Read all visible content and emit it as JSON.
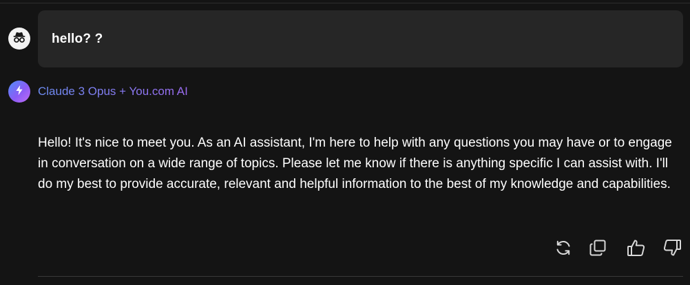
{
  "user_message": {
    "avatar_icon": "incognito-icon",
    "text": "hello? ?"
  },
  "assistant": {
    "avatar_icon": "lightning-bolt-icon",
    "model_name": "Claude 3 Opus + You.com AI",
    "response": "Hello! It's nice to meet you. As an AI assistant, I'm here to help with any questions you may have or to engage in conversation on a wide range of topics. Please let me know if there is anything specific I can assist with. I'll do my best to provide accurate, relevant and helpful information to the best of my knowledge and capabilities."
  },
  "actions": [
    {
      "name": "regenerate",
      "icon": "refresh-icon"
    },
    {
      "name": "copy",
      "icon": "copy-icon"
    },
    {
      "name": "thumbs-up",
      "icon": "thumbs-up-icon"
    },
    {
      "name": "thumbs-down",
      "icon": "thumbs-down-icon"
    }
  ],
  "colors": {
    "background": "#141414",
    "user_bubble": "#262626",
    "model_name_gradient_start": "#6e8ef5",
    "model_name_gradient_end": "#9c6cf2",
    "icon": "#d9d9d9"
  }
}
